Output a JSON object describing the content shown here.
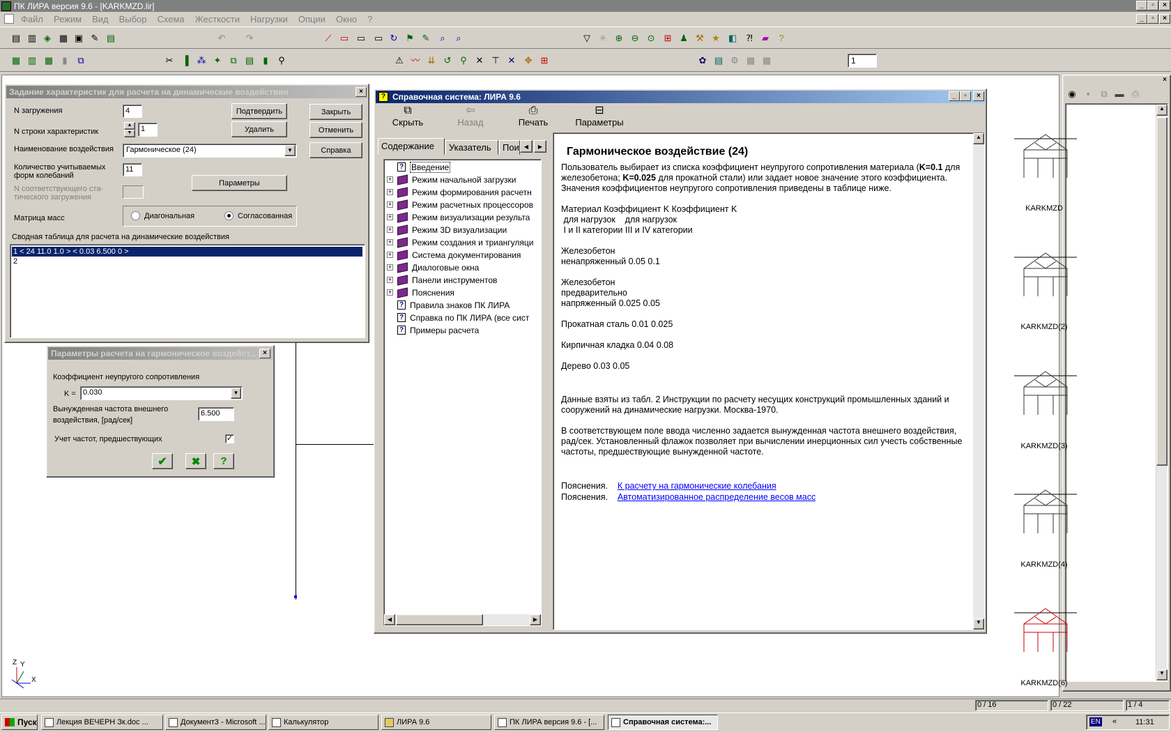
{
  "app": {
    "title": "ПК ЛИРА  версия 9.6 - [KARKMZD.lir]",
    "menu": [
      "Файл",
      "Режим",
      "Вид",
      "Выбор",
      "Схема",
      "Жесткости",
      "Нагрузки",
      "Опции",
      "Окно",
      "?"
    ]
  },
  "dyn_dialog": {
    "title": "Задание характеристик для расчета на динамические воздействия",
    "n_load_label": "N загружения",
    "n_load_value": "4",
    "n_row_label": "N строки характеристик",
    "n_row_value": "1",
    "name_label": "Наименование воздействия",
    "name_value": "Гармоническое  (24)",
    "forms_label_1": "Количество учитываемых",
    "forms_label_2": "форм колебаний",
    "forms_value": "11",
    "static_label_1": "N соответствующего ста-",
    "static_label_2": "тического загружения",
    "mass_label": "Матрица масс",
    "radio_diag": "Диагональная",
    "radio_coord": "Согласованная",
    "table_label": "Сводная таблица для расчета на динамические воздействия",
    "rows": [
      "1 < 24  11.0  1.0 > < 0.03 6.500 0 >",
      "2"
    ],
    "btn_confirm": "Подтвердить",
    "btn_delete": "Удалить",
    "btn_params": "Параметры",
    "btn_close": "Закрыть",
    "btn_cancel": "Отменить",
    "btn_help": "Справка"
  },
  "harm_dialog": {
    "title": "Параметры расчета на гармоническое воздейст...",
    "coef_label": "Коэффициент неупругого сопротивления",
    "k_label": "K =",
    "k_value": "0.030",
    "freq_label_1": "Вынужденная частота внешнего",
    "freq_label_2": "воздействия,  [рад/сек]",
    "freq_value": "6.500",
    "prev_label": "Учет частот, предшествующих"
  },
  "help_window": {
    "title": "Справочная система: ЛИРА 9.6",
    "tb_hide": "Скрыть",
    "tb_back": "Назад",
    "tb_print": "Печать",
    "tb_params": "Параметры",
    "tabs": [
      "Содержание",
      "Указатель",
      "Пои"
    ],
    "tree": [
      {
        "label": "Введение",
        "type": "q",
        "expand": false
      },
      {
        "label": "Режим начальной загрузки",
        "type": "book",
        "expand": true
      },
      {
        "label": "Режим формирования расчетн",
        "type": "book",
        "expand": true
      },
      {
        "label": "Режим расчетных процессоров",
        "type": "book",
        "expand": true
      },
      {
        "label": "Режим визуализации результа",
        "type": "book",
        "expand": true
      },
      {
        "label": "Режим 3D визуализации",
        "type": "book",
        "expand": true
      },
      {
        "label": "Режим создания и триангуляци",
        "type": "book",
        "expand": true
      },
      {
        "label": "Система документирования",
        "type": "book",
        "expand": true
      },
      {
        "label": "Диалоговые окна",
        "type": "book",
        "expand": true
      },
      {
        "label": "Панели инструментов",
        "type": "book",
        "expand": true
      },
      {
        "label": "Пояснения",
        "type": "book",
        "expand": true
      },
      {
        "label": "Правила знаков ПК ЛИРА",
        "type": "q",
        "expand": false
      },
      {
        "label": "Справка по ПК ЛИРА (все сист",
        "type": "q",
        "expand": false
      },
      {
        "label": "Примеры расчета",
        "type": "q",
        "expand": false
      }
    ],
    "heading": "Гармоническое воздействие (24)",
    "p1_a": "Пользователь выбирает из списка коэффициент неупругого сопротивления материала (",
    "p1_b": "K=0.1",
    "p1_c": " для железобетона; ",
    "p1_d": "K=0.025",
    "p1_e": " для прокатной стали) или задает новое значение этого коэффициента. Значения коэффициентов неупругого сопротивления приведены в таблице ниже.",
    "t1": "Материал Коэффициент K Коэффициент K",
    "t2": " для нагрузок    для нагрузок",
    "t3": " I и II категории III и IV категории",
    "m1a": "Железобетон",
    "m1b": "ненапряженный 0.05  0.1",
    "m2a": "Железобетон",
    "m2b": "предварительно",
    "m2c": "напряженный 0.025  0.05",
    "m3": "Прокатная сталь 0.01  0.025",
    "m4": "Кирпичная кладка 0.04  0.08",
    "m5": "Дерево 0.03  0.05",
    "p2": "Данные взяты из табл. 2 Инструкции по расчету несущих конструкций промышленных зданий и сооружений на динамические нагрузки. Москва-1970.",
    "p3": "В соответствующем поле ввода численно задается вынужденная частота внешнего воздействия, рад/сек. Установленный флажок позволяет при вычислении инерционных сил учесть собственные частоты, предшествующие вынужденной частоте.",
    "see_label": "Пояснения.",
    "link1": "К расчету на гармонические колебания",
    "link2": "Автоматизированное распределение весов масс"
  },
  "toolbar": {
    "layer_value": "1"
  },
  "thumbs": [
    "KARKMZD",
    "KARKMZD(2)",
    "KARKMZD(3)",
    "KARKMZD(4)",
    "KARKMZD(6)"
  ],
  "status": {
    "s1": "0 / 16",
    "s2": "0 / 22",
    "s3": "1 / 4"
  },
  "axes": {
    "z": "Z",
    "y": "Y",
    "x": "X"
  },
  "taskbar": {
    "start": "Пуск",
    "items": [
      "Лекция ВЕЧЕРН Зк.doc ...",
      "Документ3 - Microsoft ...",
      "Калькулятор",
      "ЛИРА 9.6",
      "ПК ЛИРА  версия 9.6 - [...",
      "Справочная система:..."
    ],
    "lang": "EN",
    "time": "11:31"
  },
  "colors": {
    "title_active": "#0a246a",
    "title_inactive": "#808080",
    "selection": "#0a246a",
    "link": "#0000ff"
  }
}
